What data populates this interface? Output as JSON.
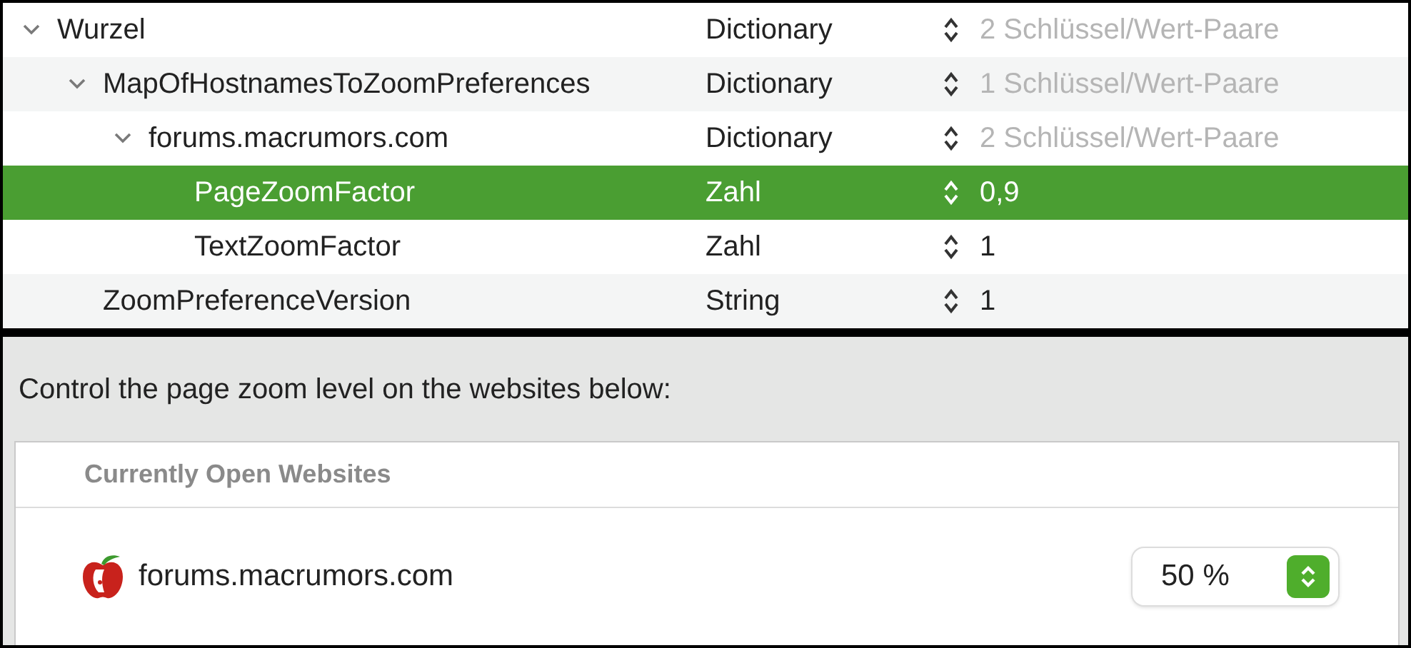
{
  "plist": {
    "rows": [
      {
        "key": "Wurzel",
        "type": "Dictionary",
        "value": "2 Schlüssel/Wert-Paare",
        "dimmed": true,
        "expanded": true,
        "selected": false,
        "children": [
          {
            "key": "MapOfHostnamesToZoomPreferences",
            "type": "Dictionary",
            "value": "1 Schlüssel/Wert-Paare",
            "dimmed": true,
            "expanded": true,
            "selected": false,
            "children": [
              {
                "key": "forums.macrumors.com",
                "type": "Dictionary",
                "value": "2 Schlüssel/Wert-Paare",
                "dimmed": true,
                "expanded": true,
                "selected": false,
                "children": [
                  {
                    "key": "PageZoomFactor",
                    "type": "Zahl",
                    "value": "0,9",
                    "dimmed": false,
                    "selected": true
                  },
                  {
                    "key": "TextZoomFactor",
                    "type": "Zahl",
                    "value": "1",
                    "dimmed": false,
                    "selected": false
                  }
                ]
              }
            ]
          },
          {
            "key": "ZoomPreferenceVersion",
            "type": "String",
            "value": "1",
            "dimmed": false,
            "selected": false
          }
        ]
      }
    ]
  },
  "zoom_settings": {
    "description": "Control the page zoom level on the websites below:",
    "table": {
      "header": "Currently Open Websites",
      "rows": [
        {
          "site": "forums.macrumors.com",
          "zoom": "50 %"
        }
      ]
    }
  }
}
